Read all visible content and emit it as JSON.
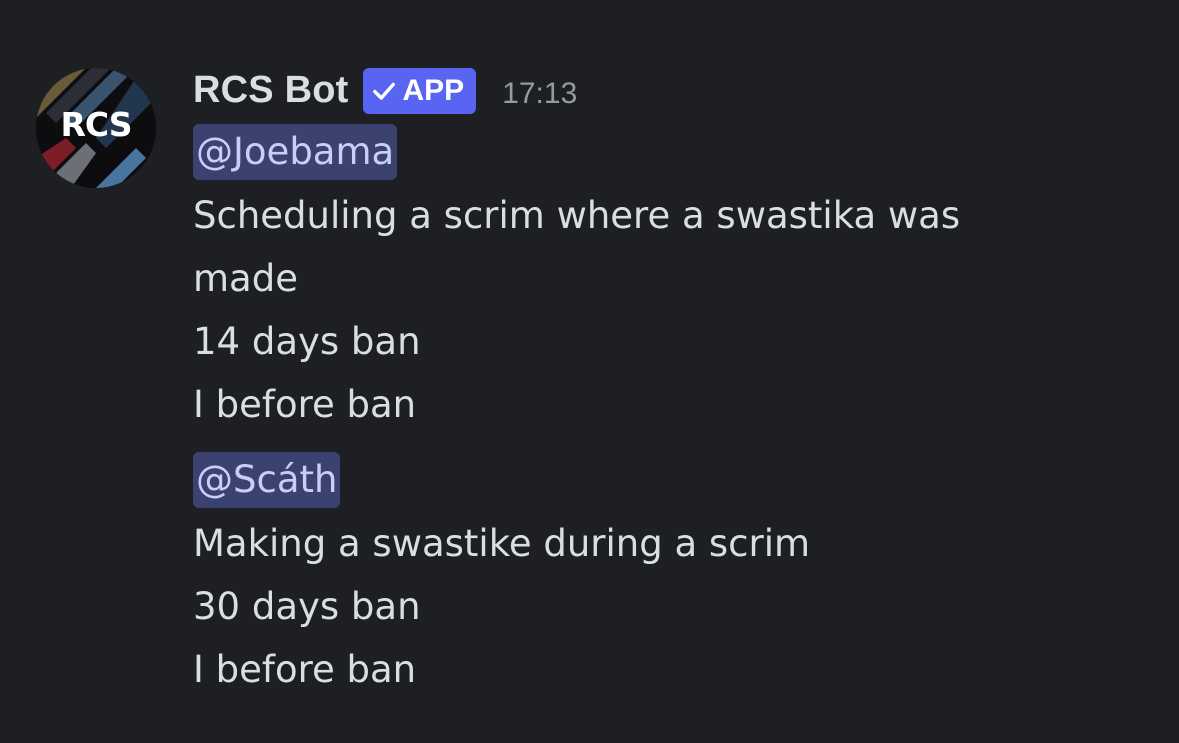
{
  "message": {
    "author": "RCS Bot",
    "badge": "APP",
    "timestamp": "17:13",
    "avatar_text": "RCS",
    "colors": {
      "background": "#1e1f23",
      "text": "#dbdee1",
      "muted": "#949ba4",
      "badge": "#5865f2",
      "mention_bg": "#3c4270",
      "mention_text": "#c9cdfb"
    },
    "icons": {
      "badge": "checkmark-icon"
    },
    "blocks": [
      {
        "mention": "@Joebama",
        "lines": [
          "Scheduling a scrim where a swastika was",
          "made",
          "14 days ban",
          "I before ban"
        ]
      },
      {
        "mention": "@Scáth",
        "lines": [
          "Making a swastike during a scrim",
          "30 days ban",
          "I before ban"
        ]
      }
    ]
  }
}
